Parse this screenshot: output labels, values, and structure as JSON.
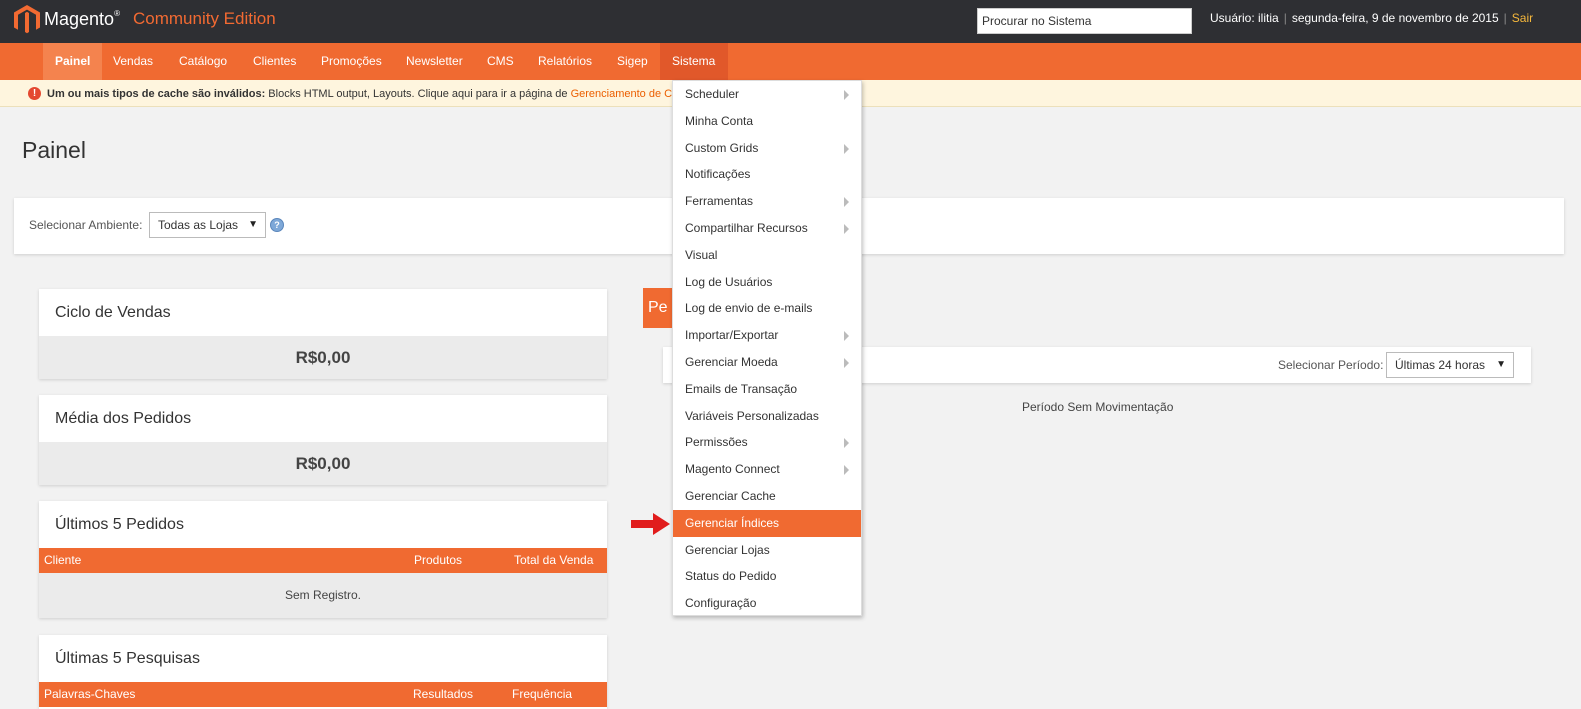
{
  "header": {
    "logo_text": "Magento",
    "logo_tm": "®",
    "edition": "Community Edition",
    "search_placeholder": "Procurar no Sistema",
    "user_label": "Usuário: ilitia",
    "date": "segunda-feira, 9 de novembro de 2015",
    "logout": "Sair",
    "colors": {
      "bar": "#2e2f33",
      "accent": "#f26a32"
    }
  },
  "nav": {
    "items": [
      {
        "label": "Painel"
      },
      {
        "label": "Vendas"
      },
      {
        "label": "Catálogo"
      },
      {
        "label": "Clientes"
      },
      {
        "label": "Promoções"
      },
      {
        "label": "Newsletter"
      },
      {
        "label": "CMS"
      },
      {
        "label": "Relatórios"
      },
      {
        "label": "Sigep"
      },
      {
        "label": "Sistema"
      }
    ],
    "active": "Painel",
    "open": "Sistema"
  },
  "message": {
    "bold": "Um ou mais tipos de cache são inválidos:",
    "text": " Blocks HTML output, Layouts. Clique aqui para ir a página de ",
    "link": "Gerenciamento de C"
  },
  "page": {
    "title": "Painel",
    "store_label": "Selecionar Ambiente:",
    "store_value": "Todas as Lojas",
    "help": "?",
    "period_label": "Selecionar Período:",
    "period_value": "Últimas 24 horas",
    "tab_text": "Pe",
    "no_movement": "Período Sem Movimentação"
  },
  "boxes": {
    "sales_cycle": {
      "title": "Ciclo de Vendas",
      "value": "R$0,00"
    },
    "avg_orders": {
      "title": "Média dos Pedidos",
      "value": "R$0,00"
    },
    "last_orders": {
      "title": "Últimos 5 Pedidos",
      "columns": [
        "Cliente",
        "Produtos",
        "Total da Venda"
      ],
      "empty": "Sem Registro."
    },
    "last_searches": {
      "title": "Últimas 5 Pesquisas",
      "columns": [
        "Palavras-Chaves",
        "Resultados",
        "Frequência"
      ]
    }
  },
  "system_menu": {
    "items": [
      {
        "label": "Scheduler",
        "submenu": true
      },
      {
        "label": "Minha Conta",
        "submenu": false
      },
      {
        "label": "Custom Grids",
        "submenu": true
      },
      {
        "label": "Notificações",
        "submenu": false
      },
      {
        "label": "Ferramentas",
        "submenu": true
      },
      {
        "label": "Compartilhar Recursos",
        "submenu": true
      },
      {
        "label": "Visual",
        "submenu": false
      },
      {
        "label": "Log de Usuários",
        "submenu": false
      },
      {
        "label": "Log de envio de e-mails",
        "submenu": false
      },
      {
        "label": "Importar/Exportar",
        "submenu": true
      },
      {
        "label": "Gerenciar Moeda",
        "submenu": true
      },
      {
        "label": "Emails de Transação",
        "submenu": false
      },
      {
        "label": "Variáveis Personalizadas",
        "submenu": false
      },
      {
        "label": "Permissões",
        "submenu": true
      },
      {
        "label": "Magento Connect",
        "submenu": true
      },
      {
        "label": "Gerenciar Cache",
        "submenu": false
      },
      {
        "label": "Gerenciar Índices",
        "submenu": false
      },
      {
        "label": "Gerenciar Lojas",
        "submenu": false
      },
      {
        "label": "Status do Pedido",
        "submenu": false
      },
      {
        "label": "Configuração",
        "submenu": false
      }
    ],
    "highlighted": "Gerenciar Índices"
  }
}
